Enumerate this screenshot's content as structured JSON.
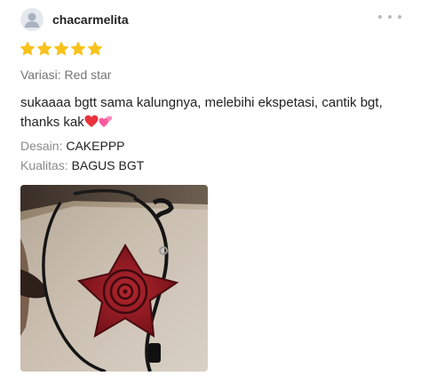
{
  "review": {
    "username": "chacarmelita",
    "rating": 5,
    "variation": {
      "label": "Variasi:",
      "value": "Red star"
    },
    "comment": "sukaaaa bgtt sama kalungnya, melebihi ekspetasi, cantik bgt, thanks kak",
    "comment_emojis": [
      "red-heart-icon",
      "two-hearts-icon"
    ],
    "attributes": [
      {
        "label": "Desain:",
        "value": "CAKEPPP"
      },
      {
        "label": "Kualitas:",
        "value": "BAGUS BGT"
      }
    ],
    "icons": {
      "avatar": "user-icon",
      "more": "more-horizontal-icon",
      "star": "star-icon"
    }
  },
  "colors": {
    "star": "#f8c21c",
    "more_dots": "#b9b9b9",
    "avatar_bg": "#e4e8ee",
    "label_gray": "#757575",
    "heart": "#e8323c",
    "two_hearts": "#ff5a9e"
  }
}
